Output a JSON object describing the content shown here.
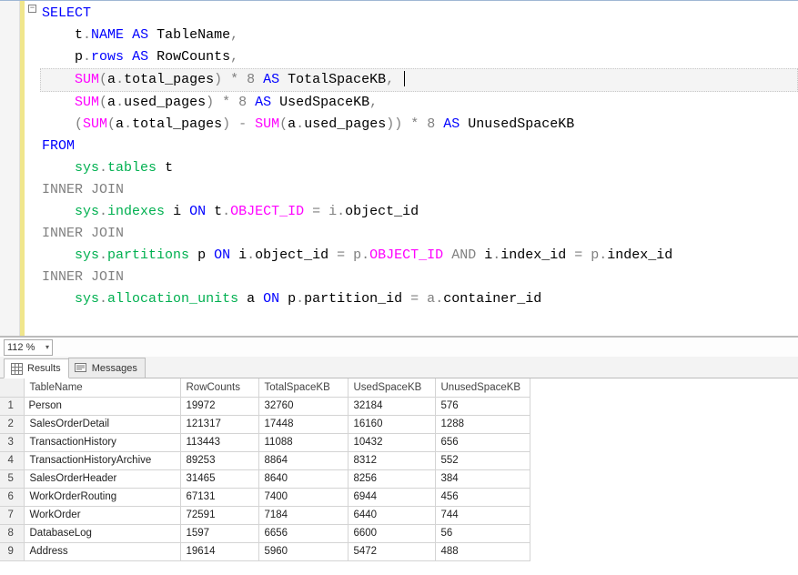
{
  "editor": {
    "collapse_glyph": "−",
    "zoom_label": "112 %",
    "code": {
      "select": "SELECT",
      "line2_pre": "    t",
      "line2_name": "NAME",
      "line2_as": "AS",
      "line2_tbl": "TableName",
      "line2_comma": ",",
      "line3_pre": "    p",
      "line3_rows": "rows",
      "line3_as": "AS",
      "line3_rc": "RowCounts",
      "line3_comma": ",",
      "line4_sum": "SUM",
      "line4_a": "a",
      "line4_tp": "total_pages",
      "line4_mult": " * 8 ",
      "line4_as": "AS",
      "line4_tskb": " TotalSpaceKB",
      "line4_comma": ",",
      "line5_sum": "SUM",
      "line5_a": "a",
      "line5_up": "used_pages",
      "line5_mult": " * 8 ",
      "line5_as": "AS",
      "line5_uskb": " UsedSpaceKB",
      "line5_comma": ",",
      "line6_open": "    (",
      "line6_sum1": "SUM",
      "line6_a1": "a",
      "line6_tp": "total_pages",
      "line6_minus": ") - ",
      "line6_sum2": "SUM",
      "line6_a2": "a",
      "line6_up": "used_pages",
      "line6_close": ")) * 8 ",
      "line6_as": "AS",
      "line6_unskb": " UnusedSpaceKB",
      "from": "FROM",
      "line8_sys": "sys",
      "line8_tables": "tables",
      "line8_t": " t",
      "ij1": "INNER",
      "ij1b": "JOIN",
      "line10_sys": "sys",
      "line10_idx": "indexes",
      "line10_i": " i ",
      "line10_on": "ON",
      "line10_t": " t",
      "line10_oid": "OBJECT_ID",
      "line10_eq": " = i",
      "line10_oid2": "object_id",
      "ij2": "INNER",
      "ij2b": "JOIN",
      "line12_sys": "sys",
      "line12_part": "partitions",
      "line12_p": " p ",
      "line12_on": "ON",
      "line12_i": " i",
      "line12_oid": "object_id",
      "line12_eq": " = p",
      "line12_OID": "OBJECT_ID",
      "line12_and": "AND",
      "line12_i2": " i",
      "line12_iid": "index_id",
      "line12_eq2": " = p",
      "line12_iid2": "index_id",
      "ij3": "INNER",
      "ij3b": "JOIN",
      "line14_sys": "sys",
      "line14_au": "allocation_units",
      "line14_a": " a ",
      "line14_on": "ON",
      "line14_p": " p",
      "line14_pid": "partition_id",
      "line14_eq": " = a",
      "line14_cid": "container_id",
      "dot": "."
    }
  },
  "tabs": {
    "results": "Results",
    "messages": "Messages"
  },
  "grid": {
    "headers": [
      "TableName",
      "RowCounts",
      "TotalSpaceKB",
      "UsedSpaceKB",
      "UnusedSpaceKB"
    ],
    "rows": [
      {
        "n": "1",
        "TableName": "Person",
        "RowCounts": "19972",
        "TotalSpaceKB": "32760",
        "UsedSpaceKB": "32184",
        "UnusedSpaceKB": "576"
      },
      {
        "n": "2",
        "TableName": "SalesOrderDetail",
        "RowCounts": "121317",
        "TotalSpaceKB": "17448",
        "UsedSpaceKB": "16160",
        "UnusedSpaceKB": "1288"
      },
      {
        "n": "3",
        "TableName": "TransactionHistory",
        "RowCounts": "113443",
        "TotalSpaceKB": "11088",
        "UsedSpaceKB": "10432",
        "UnusedSpaceKB": "656"
      },
      {
        "n": "4",
        "TableName": "TransactionHistoryArchive",
        "RowCounts": "89253",
        "TotalSpaceKB": "8864",
        "UsedSpaceKB": "8312",
        "UnusedSpaceKB": "552"
      },
      {
        "n": "5",
        "TableName": "SalesOrderHeader",
        "RowCounts": "31465",
        "TotalSpaceKB": "8640",
        "UsedSpaceKB": "8256",
        "UnusedSpaceKB": "384"
      },
      {
        "n": "6",
        "TableName": "WorkOrderRouting",
        "RowCounts": "67131",
        "TotalSpaceKB": "7400",
        "UsedSpaceKB": "6944",
        "UnusedSpaceKB": "456"
      },
      {
        "n": "7",
        "TableName": "WorkOrder",
        "RowCounts": "72591",
        "TotalSpaceKB": "7184",
        "UsedSpaceKB": "6440",
        "UnusedSpaceKB": "744"
      },
      {
        "n": "8",
        "TableName": "DatabaseLog",
        "RowCounts": "1597",
        "TotalSpaceKB": "6656",
        "UsedSpaceKB": "6600",
        "UnusedSpaceKB": "56"
      },
      {
        "n": "9",
        "TableName": "Address",
        "RowCounts": "19614",
        "TotalSpaceKB": "5960",
        "UsedSpaceKB": "5472",
        "UnusedSpaceKB": "488"
      }
    ]
  }
}
